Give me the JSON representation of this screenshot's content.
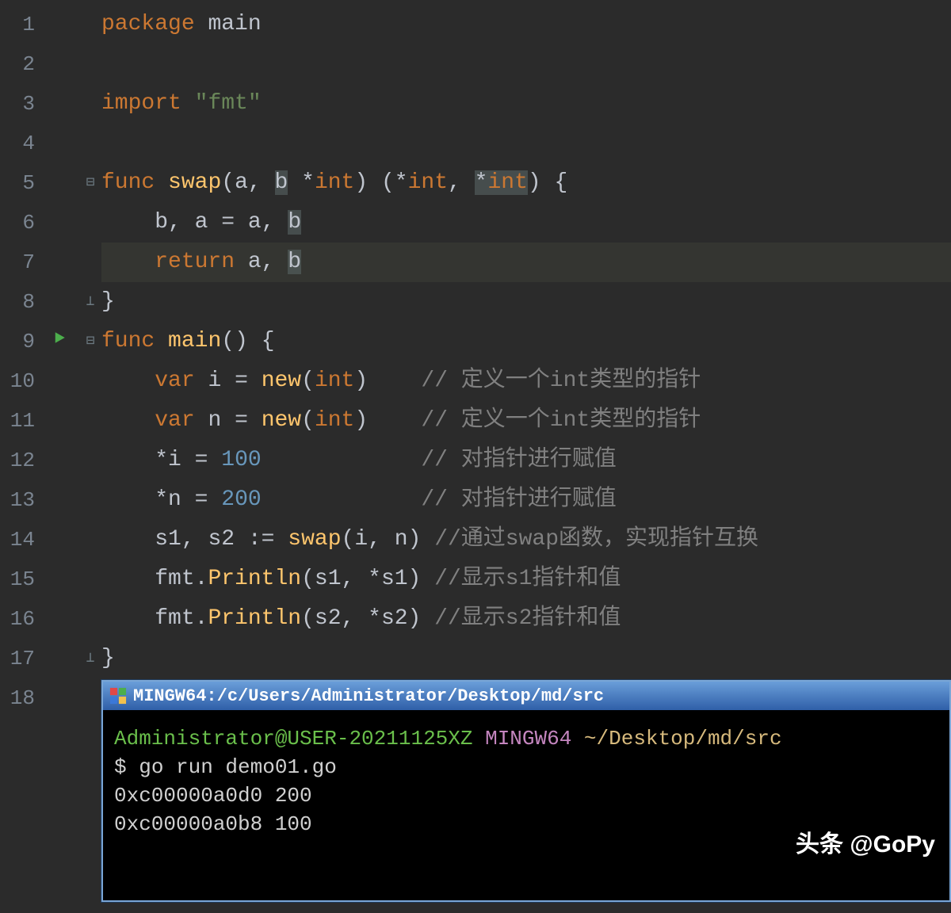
{
  "line_count": 18,
  "run_icon_line": 9,
  "highlighted_line": 7,
  "fold_markers": {
    "5": "open-start",
    "8": "open-end",
    "9": "open-start",
    "17": "open-end"
  },
  "code_tokens": {
    "1": [
      [
        "kw",
        "package"
      ],
      [
        "sp",
        " "
      ],
      [
        "id",
        "main"
      ]
    ],
    "2": [],
    "3": [
      [
        "kw",
        "import"
      ],
      [
        "sp",
        " "
      ],
      [
        "str",
        "\"fmt\""
      ]
    ],
    "4": [],
    "5": [
      [
        "kw",
        "func"
      ],
      [
        "sp",
        " "
      ],
      [
        "fn",
        "swap"
      ],
      [
        "punc",
        "("
      ],
      [
        "id",
        "a"
      ],
      [
        "punc",
        ","
      ],
      [
        "sp",
        " "
      ],
      [
        "sel_id",
        "b"
      ],
      [
        "sp",
        " "
      ],
      [
        "punc",
        "*"
      ],
      [
        "ty",
        "int"
      ],
      [
        "punc",
        ")"
      ],
      [
        "sp",
        " "
      ],
      [
        "punc",
        "("
      ],
      [
        "punc",
        "*"
      ],
      [
        "ty",
        "int"
      ],
      [
        "punc",
        ","
      ],
      [
        "sp",
        " "
      ],
      [
        "sel_punc",
        "*"
      ],
      [
        "sel_ty",
        "int"
      ],
      [
        "punc",
        ")"
      ],
      [
        "sp",
        " "
      ],
      [
        "punc",
        "{"
      ]
    ],
    "6": [
      [
        "indent",
        "    "
      ],
      [
        "id",
        "b"
      ],
      [
        "punc",
        ","
      ],
      [
        "sp",
        " "
      ],
      [
        "id",
        "a"
      ],
      [
        "sp",
        " "
      ],
      [
        "punc",
        "="
      ],
      [
        "sp",
        " "
      ],
      [
        "id",
        "a"
      ],
      [
        "punc",
        ","
      ],
      [
        "sp",
        " "
      ],
      [
        "sel_id",
        "b"
      ]
    ],
    "7": [
      [
        "indent",
        "    "
      ],
      [
        "kw",
        "return"
      ],
      [
        "sp",
        " "
      ],
      [
        "id",
        "a"
      ],
      [
        "punc",
        ","
      ],
      [
        "sp",
        " "
      ],
      [
        "sel_id",
        "b"
      ]
    ],
    "8": [
      [
        "punc",
        "}"
      ]
    ],
    "9": [
      [
        "kw",
        "func"
      ],
      [
        "sp",
        " "
      ],
      [
        "fn",
        "main"
      ],
      [
        "punc",
        "("
      ],
      [
        "punc",
        ")"
      ],
      [
        "sp",
        " "
      ],
      [
        "punc",
        "{"
      ]
    ],
    "10": [
      [
        "indent",
        "    "
      ],
      [
        "kw",
        "var"
      ],
      [
        "sp",
        " "
      ],
      [
        "id",
        "i"
      ],
      [
        "sp",
        " "
      ],
      [
        "punc",
        "="
      ],
      [
        "sp",
        " "
      ],
      [
        "fn",
        "new"
      ],
      [
        "punc",
        "("
      ],
      [
        "ty",
        "int"
      ],
      [
        "punc",
        ")"
      ],
      [
        "sp",
        "    "
      ],
      [
        "cm",
        "// 定义一个int类型的指针"
      ]
    ],
    "11": [
      [
        "indent",
        "    "
      ],
      [
        "kw",
        "var"
      ],
      [
        "sp",
        " "
      ],
      [
        "id",
        "n"
      ],
      [
        "sp",
        " "
      ],
      [
        "punc",
        "="
      ],
      [
        "sp",
        " "
      ],
      [
        "fn",
        "new"
      ],
      [
        "punc",
        "("
      ],
      [
        "ty",
        "int"
      ],
      [
        "punc",
        ")"
      ],
      [
        "sp",
        "    "
      ],
      [
        "cm",
        "// 定义一个int类型的指针"
      ]
    ],
    "12": [
      [
        "indent",
        "    "
      ],
      [
        "punc",
        "*"
      ],
      [
        "id",
        "i"
      ],
      [
        "sp",
        " "
      ],
      [
        "punc",
        "="
      ],
      [
        "sp",
        " "
      ],
      [
        "num",
        "100"
      ],
      [
        "sp",
        "            "
      ],
      [
        "cm",
        "// 对指针进行赋值"
      ]
    ],
    "13": [
      [
        "indent",
        "    "
      ],
      [
        "punc",
        "*"
      ],
      [
        "id",
        "n"
      ],
      [
        "sp",
        " "
      ],
      [
        "punc",
        "="
      ],
      [
        "sp",
        " "
      ],
      [
        "num",
        "200"
      ],
      [
        "sp",
        "            "
      ],
      [
        "cm",
        "// 对指针进行赋值"
      ]
    ],
    "14": [
      [
        "indent",
        "    "
      ],
      [
        "id",
        "s1"
      ],
      [
        "punc",
        ","
      ],
      [
        "sp",
        " "
      ],
      [
        "id",
        "s2"
      ],
      [
        "sp",
        " "
      ],
      [
        "punc",
        ":="
      ],
      [
        "sp",
        " "
      ],
      [
        "fn",
        "swap"
      ],
      [
        "punc",
        "("
      ],
      [
        "id",
        "i"
      ],
      [
        "punc",
        ","
      ],
      [
        "sp",
        " "
      ],
      [
        "id",
        "n"
      ],
      [
        "punc",
        ")"
      ],
      [
        "sp",
        " "
      ],
      [
        "cm",
        "//通过swap函数，实现指针互换"
      ]
    ],
    "15": [
      [
        "indent",
        "    "
      ],
      [
        "id",
        "fmt"
      ],
      [
        "punc",
        "."
      ],
      [
        "fn",
        "Println"
      ],
      [
        "punc",
        "("
      ],
      [
        "id",
        "s1"
      ],
      [
        "punc",
        ","
      ],
      [
        "sp",
        " "
      ],
      [
        "punc",
        "*"
      ],
      [
        "id",
        "s1"
      ],
      [
        "punc",
        ")"
      ],
      [
        "sp",
        " "
      ],
      [
        "cm",
        "//显示s1指针和值"
      ]
    ],
    "16": [
      [
        "indent",
        "    "
      ],
      [
        "id",
        "fmt"
      ],
      [
        "punc",
        "."
      ],
      [
        "fn",
        "Println"
      ],
      [
        "punc",
        "("
      ],
      [
        "id",
        "s2"
      ],
      [
        "punc",
        ","
      ],
      [
        "sp",
        " "
      ],
      [
        "punc",
        "*"
      ],
      [
        "id",
        "s2"
      ],
      [
        "punc",
        ")"
      ],
      [
        "sp",
        " "
      ],
      [
        "cm",
        "//显示s2指针和值"
      ]
    ],
    "17": [
      [
        "punc",
        "}"
      ]
    ],
    "18": []
  },
  "terminal": {
    "title": "MINGW64:/c/Users/Administrator/Desktop/md/src",
    "prompt_user": "Administrator@USER-20211125XZ",
    "prompt_env": "MINGW64",
    "prompt_path": "~/Desktop/md/src",
    "command_prefix": "$ ",
    "command": "go run demo01.go",
    "output_lines": [
      "0xc00000a0d0  200",
      "0xc00000a0b8  100"
    ]
  },
  "watermark": "头条 @GoPy"
}
